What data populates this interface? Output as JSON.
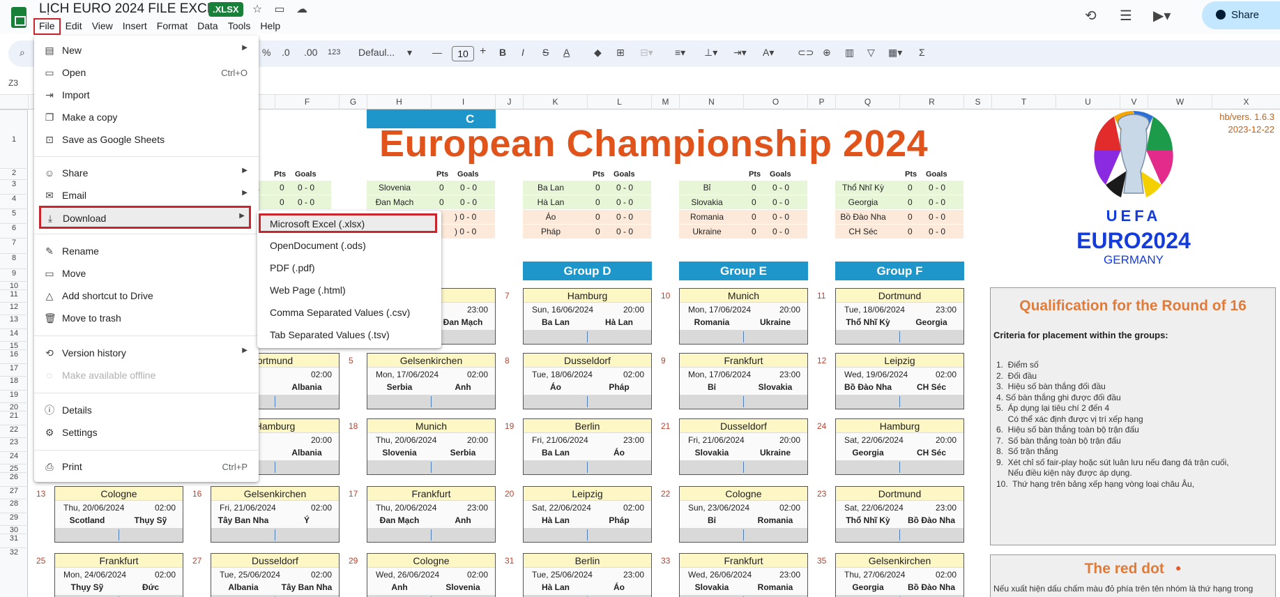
{
  "app": {
    "doc_title": "LỊCH EURO 2024 FILE EXCEL",
    "badge": ".XLSX",
    "share_label": "Share",
    "menu": [
      "File",
      "Edit",
      "View",
      "Insert",
      "Format",
      "Data",
      "Tools",
      "Help"
    ]
  },
  "toolbar": {
    "percent": "%",
    "dec_less": ".0",
    "dec_more": ".00",
    "num_format": "123",
    "font": "Defaul...",
    "font_size": "10",
    "minus": "—",
    "plus": "+"
  },
  "namebox": "Z3",
  "columns": [
    "E",
    "F",
    "G",
    "H",
    "I",
    "J",
    "K",
    "L",
    "M",
    "N",
    "O",
    "P",
    "Q",
    "R",
    "S",
    "T",
    "U",
    "V",
    "W",
    "X"
  ],
  "rows": [
    "1",
    "2",
    "3",
    "4",
    "5",
    "6",
    "7",
    "8",
    "9",
    "10",
    "11",
    "12",
    "13",
    "14",
    "15",
    "16",
    "17",
    "18",
    "19",
    "20",
    "21",
    "22",
    "23",
    "24",
    "25",
    "26",
    "27",
    "28",
    "29",
    "30",
    "31",
    "32"
  ],
  "file_menu": {
    "new": "New",
    "open": "Open",
    "open_sc": "Ctrl+O",
    "import": "Import",
    "copy": "Make a copy",
    "save_sheets": "Save as Google Sheets",
    "share": "Share",
    "email": "Email",
    "download": "Download",
    "rename": "Rename",
    "move": "Move",
    "shortcut": "Add shortcut to Drive",
    "trash": "Move to trash",
    "version": "Version history",
    "offline": "Make available offline",
    "details": "Details",
    "settings": "Settings",
    "print": "Print",
    "print_sc": "Ctrl+P"
  },
  "download_menu": [
    "Microsoft Excel (.xlsx)",
    "OpenDocument (.ods)",
    "PDF (.pdf)",
    "Web Page (.html)",
    "Comma Separated Values (.csv)",
    "Tab Separated Values (.tsv)"
  ],
  "sheet": {
    "title": "European Championship 2024",
    "version": "hb/vers. 1.6.3",
    "version_date": "2023-12-22",
    "pts": "Pts",
    "goals": "Goals",
    "standings_a": [
      {
        "team": "a",
        "pts": "0",
        "goals": "0 - 0"
      },
      {
        "team": "",
        "pts": "0",
        "goals": "0 - 0"
      }
    ],
    "standings_c": [
      {
        "team": "Slovenia",
        "pts": "0",
        "goals": "0 - 0"
      },
      {
        "team": "Đan Mạch",
        "pts": "0",
        "goals": "0 - 0"
      },
      {
        "team": "",
        "pts": "",
        "goals": ") 0 - 0"
      },
      {
        "team": "",
        "pts": "",
        "goals": ") 0 - 0"
      }
    ],
    "standings_d": [
      {
        "team": "Ba Lan",
        "pts": "0",
        "goals": "0 - 0"
      },
      {
        "team": "Hà Lan",
        "pts": "0",
        "goals": "0 - 0"
      },
      {
        "team": "Áo",
        "pts": "0",
        "goals": "0 - 0"
      },
      {
        "team": "Pháp",
        "pts": "0",
        "goals": "0 - 0"
      }
    ],
    "standings_e": [
      {
        "team": "Bỉ",
        "pts": "0",
        "goals": "0 - 0"
      },
      {
        "team": "Slovakia",
        "pts": "0",
        "goals": "0 - 0"
      },
      {
        "team": "Romania",
        "pts": "0",
        "goals": "0 - 0"
      },
      {
        "team": "Ukraine",
        "pts": "0",
        "goals": "0 - 0"
      }
    ],
    "standings_f": [
      {
        "team": "Thổ Nhĩ Kỳ",
        "pts": "0",
        "goals": "0 - 0"
      },
      {
        "team": "Georgia",
        "pts": "0",
        "goals": "0 - 0"
      },
      {
        "team": "Bồ Đào Nha",
        "pts": "0",
        "goals": "0 - 0"
      },
      {
        "team": "CH Séc",
        "pts": "0",
        "goals": "0 - 0"
      }
    ],
    "groups": {
      "c": "C",
      "d": "Group D",
      "e": "Group E",
      "f": "Group F"
    },
    "matches": {
      "c1": {
        "num": "",
        "city": "rt",
        "date": "",
        "time": "23:00",
        "a": "",
        "b": "Đan Mạch"
      },
      "d1": {
        "num": "7",
        "city": "Hamburg",
        "date": "Sun, 16/06/2024",
        "time": "20:00",
        "a": "Ba Lan",
        "b": "Hà Lan"
      },
      "e1": {
        "num": "10",
        "city": "Munich",
        "date": "Mon, 17/06/2024",
        "time": "20:00",
        "a": "Romania",
        "b": "Ukraine"
      },
      "f1": {
        "num": "11",
        "city": "Dortmund",
        "date": "Tue, 18/06/2024",
        "time": "23:00",
        "a": "Thổ Nhĩ Kỳ",
        "b": "Georgia"
      },
      "b2": {
        "num": "",
        "city": "ortmund",
        "date": "6/2024",
        "time": "02:00",
        "a": "",
        "b": "Albania"
      },
      "c2": {
        "num": "5",
        "city": "Gelsenkirchen",
        "date": "Mon, 17/06/2024",
        "time": "02:00",
        "a": "Serbia",
        "b": "Anh"
      },
      "d2": {
        "num": "8",
        "city": "Dusseldorf",
        "date": "Tue, 18/06/2024",
        "time": "02:00",
        "a": "Áo",
        "b": "Pháp"
      },
      "e2": {
        "num": "9",
        "city": "Frankfurt",
        "date": "Mon, 17/06/2024",
        "time": "23:00",
        "a": "Bỉ",
        "b": "Slovakia"
      },
      "f2": {
        "num": "12",
        "city": "Leipzig",
        "date": "Wed, 19/06/2024",
        "time": "02:00",
        "a": "Bồ Đào Nha",
        "b": "CH Séc"
      },
      "b3": {
        "num": "",
        "city": "Hamburg",
        "date": "06/2024",
        "time": "20:00",
        "a": "",
        "b": "Albania"
      },
      "c3": {
        "num": "18",
        "city": "Munich",
        "date": "Thu, 20/06/2024",
        "time": "20:00",
        "a": "Slovenia",
        "b": "Serbia"
      },
      "d3": {
        "num": "19",
        "city": "Berlin",
        "date": "Fri, 21/06/2024",
        "time": "23:00",
        "a": "Ba Lan",
        "b": "Áo"
      },
      "e3": {
        "num": "21",
        "city": "Dusseldorf",
        "date": "Fri, 21/06/2024",
        "time": "20:00",
        "a": "Slovakia",
        "b": "Ukraine"
      },
      "f3": {
        "num": "24",
        "city": "Hamburg",
        "date": "Sat, 22/06/2024",
        "time": "20:00",
        "a": "Georgia",
        "b": "CH Séc"
      },
      "a4": {
        "num": "13",
        "city": "Cologne",
        "date": "Thu, 20/06/2024",
        "time": "02:00",
        "a": "Scotland",
        "b": "Thụy Sỹ"
      },
      "b4": {
        "num": "16",
        "city": "Gelsenkirchen",
        "date": "Fri, 21/06/2024",
        "time": "02:00",
        "a": "Tây Ban Nha",
        "b": "Ý"
      },
      "c4": {
        "num": "17",
        "city": "Frankfurt",
        "date": "Thu, 20/06/2024",
        "time": "23:00",
        "a": "Đan Mạch",
        "b": "Anh"
      },
      "d4": {
        "num": "20",
        "city": "Leipzig",
        "date": "Sat, 22/06/2024",
        "time": "02:00",
        "a": "Hà Lan",
        "b": "Pháp"
      },
      "e4": {
        "num": "22",
        "city": "Cologne",
        "date": "Sun, 23/06/2024",
        "time": "02:00",
        "a": "Bỉ",
        "b": "Romania"
      },
      "f4": {
        "num": "23",
        "city": "Dortmund",
        "date": "Sat, 22/06/2024",
        "time": "23:00",
        "a": "Thổ Nhĩ Kỳ",
        "b": "Bồ Đào Nha"
      },
      "a5": {
        "num": "25",
        "city": "Frankfurt",
        "date": "Mon, 24/06/2024",
        "time": "02:00",
        "a": "Thụy Sỹ",
        "b": "Đức"
      },
      "b5": {
        "num": "27",
        "city": "Dusseldorf",
        "date": "Tue, 25/06/2024",
        "time": "02:00",
        "a": "Albania",
        "b": "Tây Ban Nha"
      },
      "c5": {
        "num": "29",
        "city": "Cologne",
        "date": "Wed, 26/06/2024",
        "time": "02:00",
        "a": "Anh",
        "b": "Slovenia"
      },
      "d5": {
        "num": "31",
        "city": "Berlin",
        "date": "Tue, 25/06/2024",
        "time": "23:00",
        "a": "Hà Lan",
        "b": "Áo"
      },
      "e5": {
        "num": "33",
        "city": "Frankfurt",
        "date": "Wed, 26/06/2024",
        "time": "23:00",
        "a": "Slovakia",
        "b": "Romania"
      },
      "f5": {
        "num": "35",
        "city": "Gelsenkirchen",
        "date": "Thu, 27/06/2024",
        "time": "02:00",
        "a": "Georgia",
        "b": "Bồ Đào Nha"
      }
    },
    "logo": {
      "uefa": "UEFA",
      "euro": "EURO2024",
      "country": "GERMANY"
    },
    "qualification": {
      "title": "Qualification for the Round of 16",
      "subtitle": "Criteria for placement within the groups:",
      "items": [
        "1.  Điểm số",
        "2.  Đối đầu",
        "3.  Hiệu số bàn thắng đối đầu",
        "4. Số bàn thắng ghi được đối đầu",
        "5.  Áp dụng lại tiêu chí 2 đến 4",
        "     Có thể xác định được vị trí xếp hạng",
        "6.  Hiệu số bàn thắng toàn bộ trận đấu",
        "7.  Số bàn thắng toàn bộ trận đấu",
        "8.  Số trận thắng",
        "9.  Xét chỉ số fair-play hoặc sút luân lưu nếu đang đá trận cuối,",
        "     Nếu điều kiện này được áp dụng.",
        "10.  Thứ hạng trên bảng xếp hạng vòng loại châu Âu,"
      ]
    },
    "reddot": {
      "title": "The red dot",
      "text": "Nếu xuất hiện dấu chấm màu đỏ phía trên tên nhóm là thứ hạng trong"
    }
  }
}
